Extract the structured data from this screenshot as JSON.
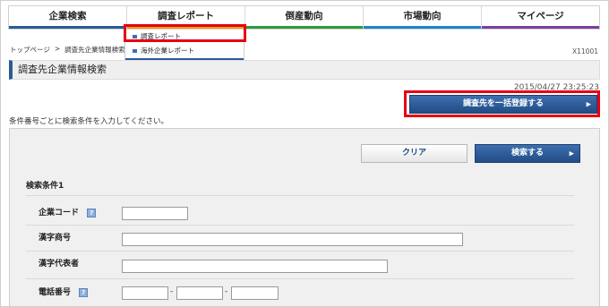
{
  "nav": {
    "items": [
      {
        "label": "企業検索",
        "color": "#2a5b97"
      },
      {
        "label": "調査レポート",
        "color": "#e8a200"
      },
      {
        "label": "倒産動向",
        "color": "#2e9b3b"
      },
      {
        "label": "市場動向",
        "color": "#1b86c9"
      },
      {
        "label": "マイページ",
        "color": "#7b3fa0"
      }
    ],
    "dropdown": [
      {
        "label": "調査レポート"
      },
      {
        "label": "海外企業レポート"
      }
    ]
  },
  "breadcrumb": {
    "home": "トップページ",
    "separator": ">",
    "current": "調査先企業情報検索"
  },
  "page_id": "X11001",
  "title": "調査先企業情報検索",
  "timestamp": "2015/04/27 23:25:23",
  "bulk_register_button": "調査先を一括登録する",
  "instruction": "条件番号ごとに検索条件を入力してください。",
  "clear_button": "クリア",
  "search_button": "検索する",
  "section_label": "検索条件1",
  "fields": {
    "company_code": {
      "label": "企業コード",
      "value": ""
    },
    "kanji_name": {
      "label": "漢字商号",
      "value": ""
    },
    "kanji_rep": {
      "label": "漢字代表者",
      "value": ""
    },
    "phone": {
      "label": "電話番号",
      "value1": "",
      "value2": "",
      "value3": "",
      "separator": "-"
    }
  },
  "colors": {
    "accent": "#2a5b97",
    "highlight": "#e60012"
  }
}
